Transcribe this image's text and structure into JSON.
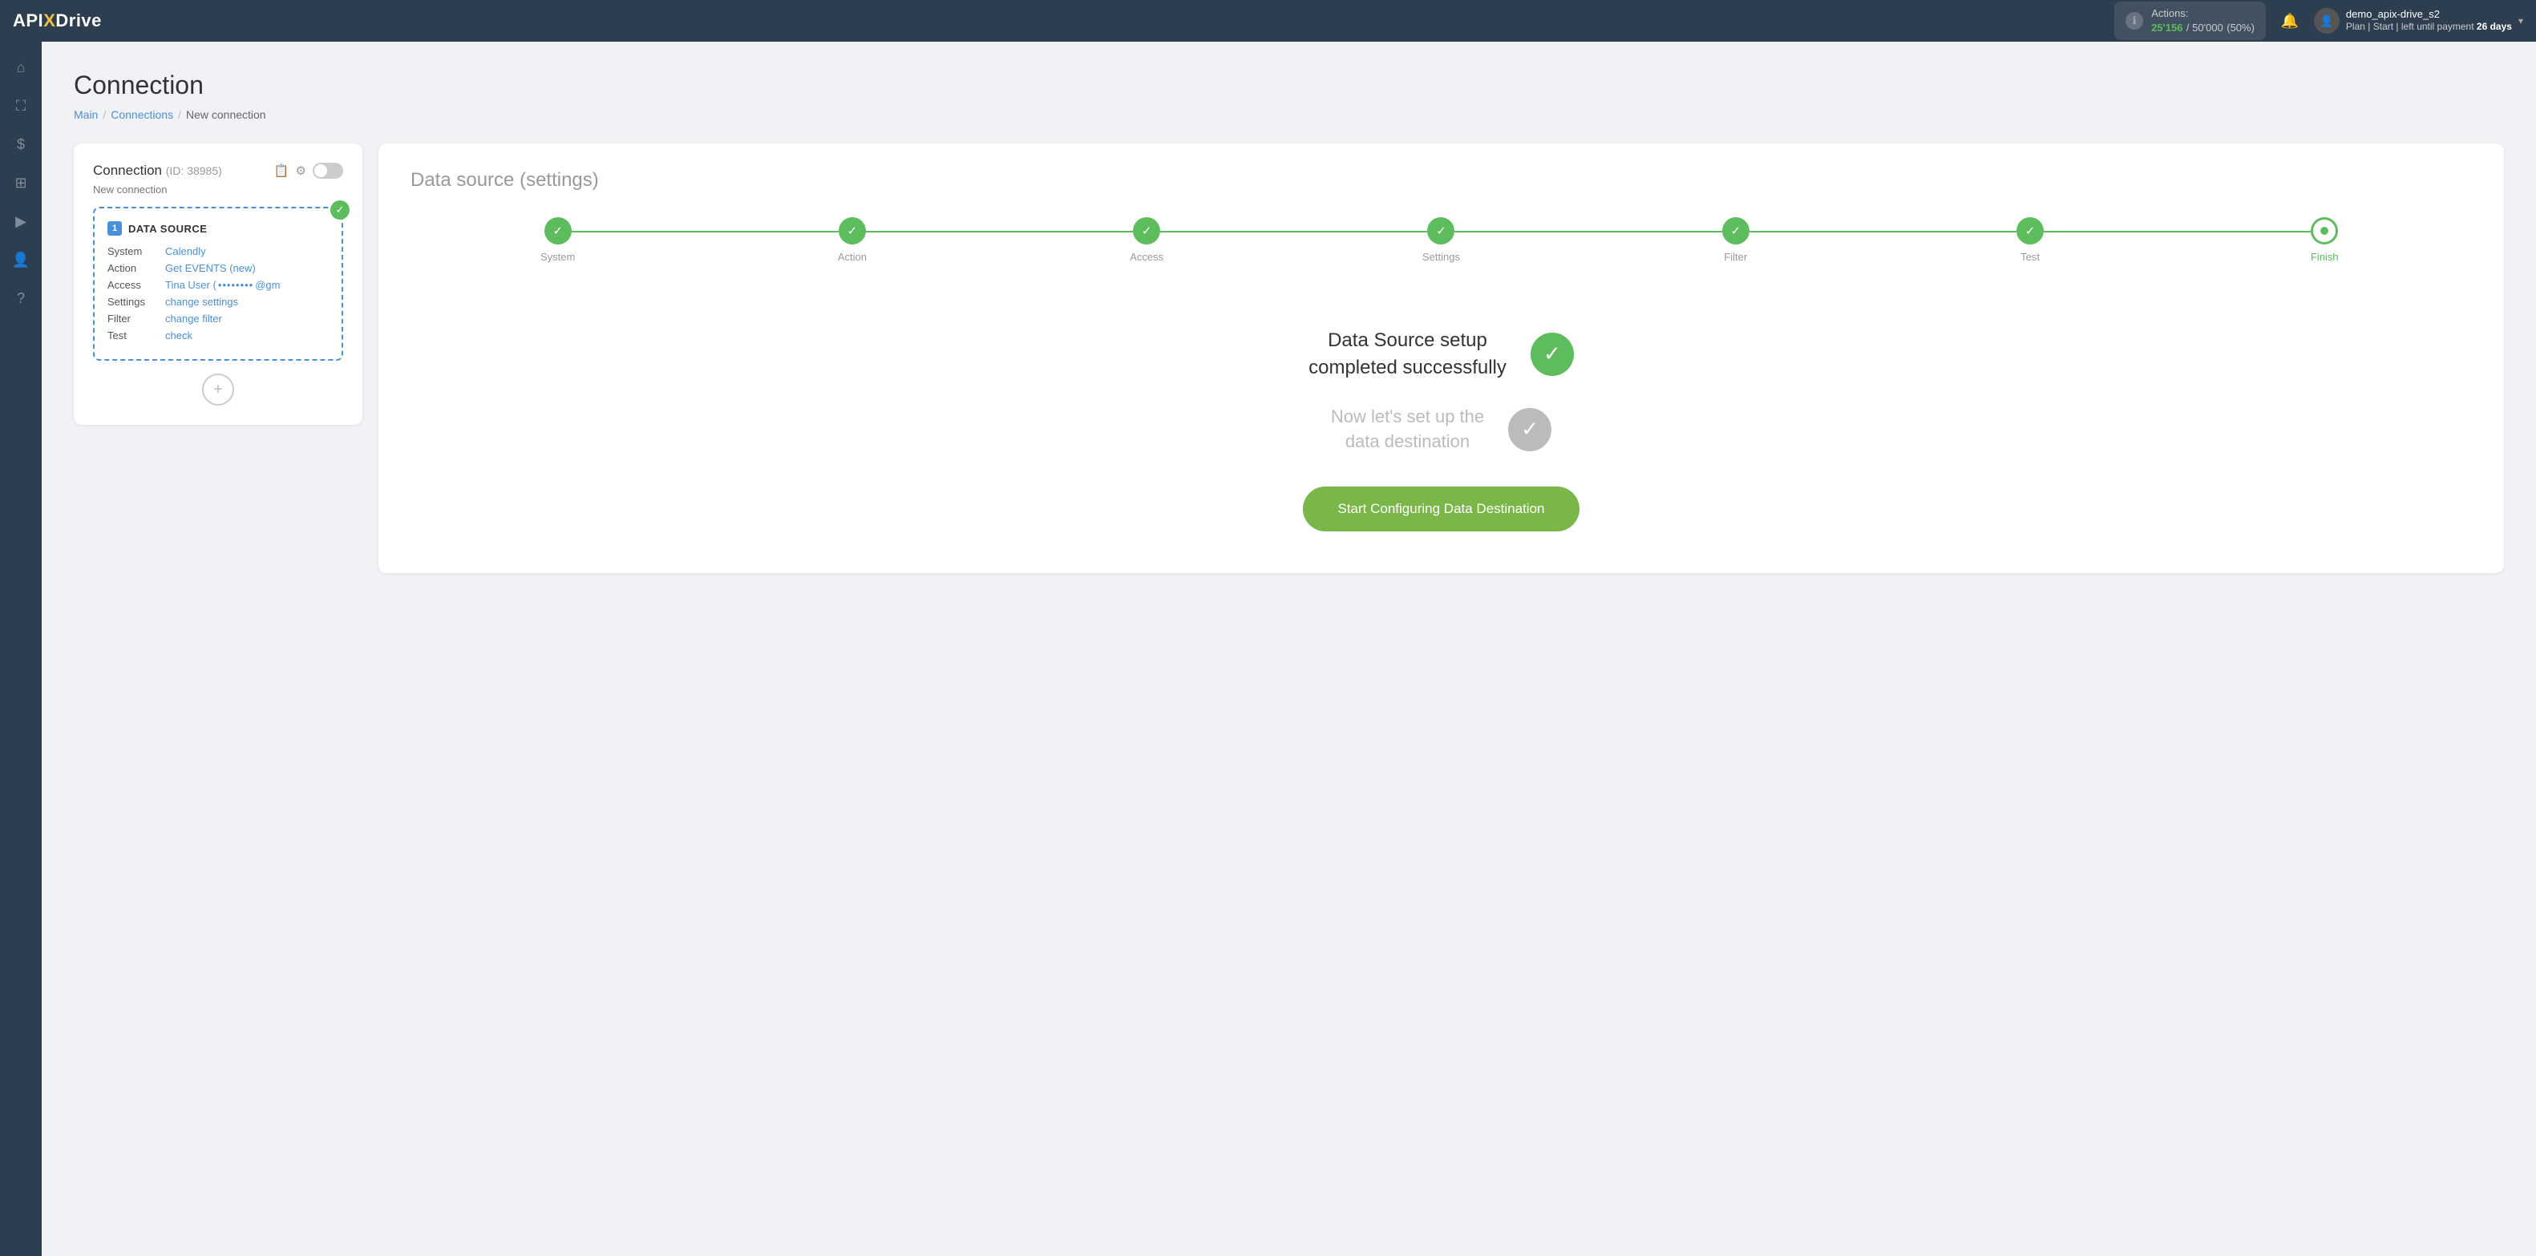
{
  "topbar": {
    "logo": "API",
    "logo_x": "X",
    "logo_drive": "Drive",
    "actions_label": "Actions:",
    "actions_used": "25'156",
    "actions_total": "50'000",
    "actions_pct": "(50%)",
    "user_name": "demo_apix-drive_s2",
    "plan_text": "Plan | Start | left until payment",
    "days_left": "26 days"
  },
  "sidebar": {
    "items": [
      {
        "icon": "⌂",
        "name": "home-icon"
      },
      {
        "icon": "⛶",
        "name": "connections-icon"
      },
      {
        "icon": "$",
        "name": "billing-icon"
      },
      {
        "icon": "⊞",
        "name": "integrations-icon"
      },
      {
        "icon": "▶",
        "name": "tutorial-icon"
      },
      {
        "icon": "👤",
        "name": "profile-icon"
      },
      {
        "icon": "?",
        "name": "help-icon"
      }
    ]
  },
  "breadcrumb": {
    "main": "Main",
    "connections": "Connections",
    "current": "New connection",
    "sep": "/"
  },
  "page_title": "Connection",
  "left_panel": {
    "title": "Connection",
    "id_text": "(ID: 38985)",
    "new_connection_label": "New connection",
    "data_source_label": "DATA SOURCE",
    "ds_number": "1",
    "rows": [
      {
        "label": "System",
        "value": "Calendly",
        "is_link": true
      },
      {
        "label": "Action",
        "value": "Get EVENTS (new)",
        "is_link": true
      },
      {
        "label": "Access",
        "value": "Tina User (",
        "masked": "••••••••",
        "suffix": "@gm",
        "is_link": true
      },
      {
        "label": "Settings",
        "value": "change settings",
        "is_link": true
      },
      {
        "label": "Filter",
        "value": "change filter",
        "is_link": true
      },
      {
        "label": "Test",
        "value": "check",
        "is_link": true
      }
    ],
    "add_btn_icon": "+"
  },
  "right_panel": {
    "title": "Data source",
    "title_sub": "(settings)",
    "steps": [
      {
        "label": "System",
        "done": true,
        "active": false
      },
      {
        "label": "Action",
        "done": true,
        "active": false
      },
      {
        "label": "Access",
        "done": true,
        "active": false
      },
      {
        "label": "Settings",
        "done": true,
        "active": false
      },
      {
        "label": "Filter",
        "done": true,
        "active": false
      },
      {
        "label": "Test",
        "done": true,
        "active": false
      },
      {
        "label": "Finish",
        "done": false,
        "active": true
      }
    ],
    "success_primary": "Data Source setup\ncompleted successfully",
    "success_secondary": "Now let's set up the\ndata destination",
    "start_btn": "Start Configuring Data Destination"
  }
}
